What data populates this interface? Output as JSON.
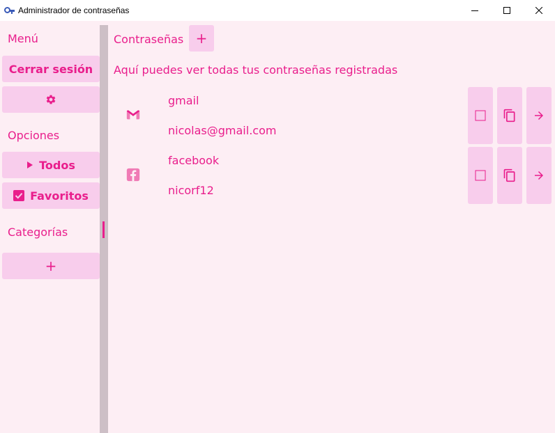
{
  "window": {
    "title": "Administrador de contraseñas",
    "icon": "keys-app-icon"
  },
  "colors": {
    "accent": "#e91e8c",
    "button_bg": "#f8cdec",
    "background": "#fdeef4",
    "divider": "#cdbfc6"
  },
  "sidebar": {
    "menu_heading": "Menú",
    "logout_label": "Cerrar sesión",
    "settings_icon": "gear-icon",
    "options_heading": "Opciones",
    "all_label": "Todos",
    "favorites_label": "Favoritos",
    "categories_heading": "Categorías",
    "add_category_label": "+"
  },
  "main": {
    "title": "Contraseñas",
    "add_label": "+",
    "subtitle": "Aquí puedes ver todas tus contraseñas registradas",
    "entries": [
      {
        "name": "gmail",
        "user": "nicolas@gmail.com",
        "icon": "gmail-icon",
        "favorite": false
      },
      {
        "name": "facebook",
        "user": "nicorf12",
        "icon": "facebook-icon",
        "favorite": false
      }
    ]
  }
}
